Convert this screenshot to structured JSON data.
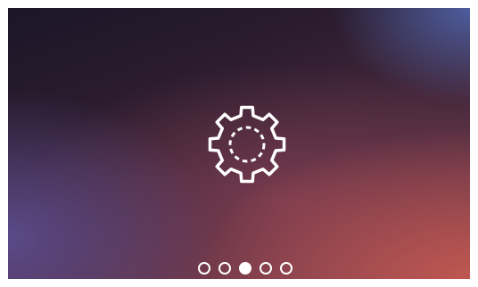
{
  "screen": {
    "icon": "gear-icon",
    "background_colors": [
      "#1b1628",
      "#4a2a3e",
      "#8a4452",
      "#5f5096",
      "#c85a50"
    ]
  },
  "pagination": {
    "total": 5,
    "active_index": 2,
    "dot_color": "#ffffff"
  }
}
